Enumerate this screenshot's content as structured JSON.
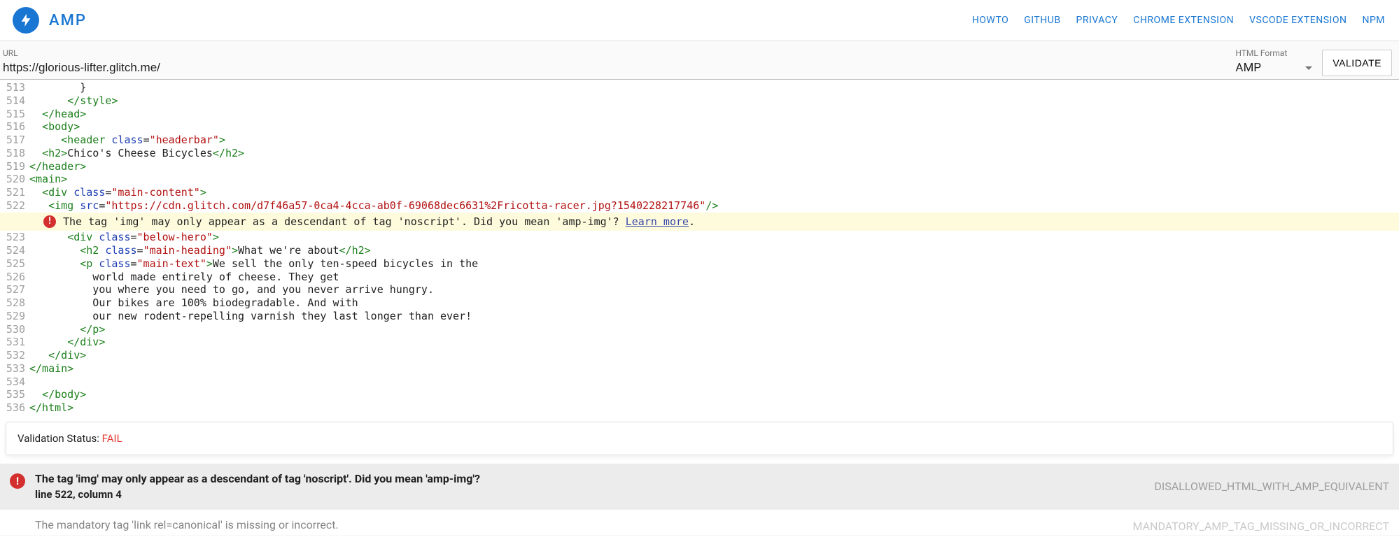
{
  "header": {
    "brand": "AMP",
    "nav": [
      {
        "label": "HOWTO"
      },
      {
        "label": "GITHUB"
      },
      {
        "label": "PRIVACY"
      },
      {
        "label": "CHROME EXTENSION"
      },
      {
        "label": "VSCODE EXTENSION"
      },
      {
        "label": "NPM"
      }
    ]
  },
  "toolbar": {
    "url_label": "URL",
    "url_value": "https://glorious-lifter.glitch.me/",
    "format_label": "HTML Format",
    "format_value": "AMP",
    "validate_label": "VALIDATE"
  },
  "code_lines": [
    {
      "n": 513,
      "tokens": [
        {
          "t": "plain",
          "v": "        }"
        }
      ]
    },
    {
      "n": 514,
      "tokens": [
        {
          "t": "plain",
          "v": "      "
        },
        {
          "t": "tag",
          "v": "</style>"
        }
      ]
    },
    {
      "n": 515,
      "tokens": [
        {
          "t": "plain",
          "v": "  "
        },
        {
          "t": "tag",
          "v": "</head>"
        }
      ]
    },
    {
      "n": 516,
      "tokens": [
        {
          "t": "plain",
          "v": "  "
        },
        {
          "t": "tag",
          "v": "<body>"
        }
      ]
    },
    {
      "n": 517,
      "tokens": [
        {
          "t": "plain",
          "v": "     "
        },
        {
          "t": "tag",
          "v": "<header"
        },
        {
          "t": "plain",
          "v": " "
        },
        {
          "t": "attr-name",
          "v": "class"
        },
        {
          "t": "plain",
          "v": "="
        },
        {
          "t": "attr-value",
          "v": "\"headerbar\""
        },
        {
          "t": "tag",
          "v": ">"
        }
      ]
    },
    {
      "n": 518,
      "tokens": [
        {
          "t": "plain",
          "v": "  "
        },
        {
          "t": "tag",
          "v": "<h2>"
        },
        {
          "t": "plain",
          "v": "Chico's Cheese Bicycles"
        },
        {
          "t": "tag",
          "v": "</h2>"
        }
      ]
    },
    {
      "n": 519,
      "tokens": [
        {
          "t": "tag",
          "v": "</header>"
        }
      ]
    },
    {
      "n": 520,
      "tokens": [
        {
          "t": "tag",
          "v": "<main>"
        }
      ]
    },
    {
      "n": 521,
      "tokens": [
        {
          "t": "plain",
          "v": "  "
        },
        {
          "t": "tag",
          "v": "<div"
        },
        {
          "t": "plain",
          "v": " "
        },
        {
          "t": "attr-name",
          "v": "class"
        },
        {
          "t": "plain",
          "v": "="
        },
        {
          "t": "attr-value",
          "v": "\"main-content\""
        },
        {
          "t": "tag",
          "v": ">"
        }
      ]
    },
    {
      "n": 522,
      "tokens": [
        {
          "t": "plain",
          "v": "   "
        },
        {
          "t": "tag",
          "v": "<img"
        },
        {
          "t": "plain",
          "v": " "
        },
        {
          "t": "attr-name",
          "v": "src"
        },
        {
          "t": "plain",
          "v": "="
        },
        {
          "t": "attr-value",
          "v": "\"https://cdn.glitch.com/d7f46a57-0ca4-4cca-ab0f-69068dec6631%2Fricotta-racer.jpg?1540228217746\""
        },
        {
          "t": "tag",
          "v": "/>"
        }
      ]
    }
  ],
  "inline_error": {
    "message": "The tag 'img' may only appear as a descendant of tag 'noscript'. Did you mean 'amp-img'? ",
    "link_text": "Learn more",
    "suffix": "."
  },
  "code_lines_after": [
    {
      "n": 523,
      "tokens": [
        {
          "t": "plain",
          "v": "      "
        },
        {
          "t": "tag",
          "v": "<div"
        },
        {
          "t": "plain",
          "v": " "
        },
        {
          "t": "attr-name",
          "v": "class"
        },
        {
          "t": "plain",
          "v": "="
        },
        {
          "t": "attr-value",
          "v": "\"below-hero\""
        },
        {
          "t": "tag",
          "v": ">"
        }
      ]
    },
    {
      "n": 524,
      "tokens": [
        {
          "t": "plain",
          "v": "        "
        },
        {
          "t": "tag",
          "v": "<h2"
        },
        {
          "t": "plain",
          "v": " "
        },
        {
          "t": "attr-name",
          "v": "class"
        },
        {
          "t": "plain",
          "v": "="
        },
        {
          "t": "attr-value",
          "v": "\"main-heading\""
        },
        {
          "t": "tag",
          "v": ">"
        },
        {
          "t": "plain",
          "v": "What we're about"
        },
        {
          "t": "tag",
          "v": "</h2>"
        }
      ]
    },
    {
      "n": 525,
      "tokens": [
        {
          "t": "plain",
          "v": "        "
        },
        {
          "t": "tag",
          "v": "<p"
        },
        {
          "t": "plain",
          "v": " "
        },
        {
          "t": "attr-name",
          "v": "class"
        },
        {
          "t": "plain",
          "v": "="
        },
        {
          "t": "attr-value",
          "v": "\"main-text\""
        },
        {
          "t": "tag",
          "v": ">"
        },
        {
          "t": "plain",
          "v": "We sell the only ten-speed bicycles in the "
        }
      ]
    },
    {
      "n": 526,
      "tokens": [
        {
          "t": "plain",
          "v": "          world made entirely of cheese. They get "
        }
      ]
    },
    {
      "n": 527,
      "tokens": [
        {
          "t": "plain",
          "v": "          you where you need to go, and you never arrive hungry. "
        }
      ]
    },
    {
      "n": 528,
      "tokens": [
        {
          "t": "plain",
          "v": "          Our bikes are 100% biodegradable. And with "
        }
      ]
    },
    {
      "n": 529,
      "tokens": [
        {
          "t": "plain",
          "v": "          our new rodent-repelling varnish they last longer than ever!"
        }
      ]
    },
    {
      "n": 530,
      "tokens": [
        {
          "t": "plain",
          "v": "        "
        },
        {
          "t": "tag",
          "v": "</p>"
        }
      ]
    },
    {
      "n": 531,
      "tokens": [
        {
          "t": "plain",
          "v": "      "
        },
        {
          "t": "tag",
          "v": "</div>"
        }
      ]
    },
    {
      "n": 532,
      "tokens": [
        {
          "t": "plain",
          "v": "   "
        },
        {
          "t": "tag",
          "v": "</div>"
        }
      ]
    },
    {
      "n": 533,
      "tokens": [
        {
          "t": "tag",
          "v": "</main>"
        }
      ]
    },
    {
      "n": 534,
      "tokens": [
        {
          "t": "plain",
          "v": ""
        }
      ]
    },
    {
      "n": 535,
      "tokens": [
        {
          "t": "plain",
          "v": "  "
        },
        {
          "t": "tag",
          "v": "</body>"
        }
      ]
    },
    {
      "n": 536,
      "tokens": [
        {
          "t": "tag",
          "v": "</html>"
        }
      ]
    }
  ],
  "status": {
    "label": "Validation Status: ",
    "value": "FAIL"
  },
  "errors": [
    {
      "title": "The tag 'img' may only appear as a descendant of tag 'noscript'. Did you mean 'amp-img'?",
      "location": "line 522, column 4",
      "code": "DISALLOWED_HTML_WITH_AMP_EQUIVALENT"
    }
  ],
  "partial_error": {
    "title": "The mandatory tag 'link rel=canonical' is missing or incorrect.",
    "code": "MANDATORY_AMP_TAG_MISSING_OR_INCORRECT"
  }
}
